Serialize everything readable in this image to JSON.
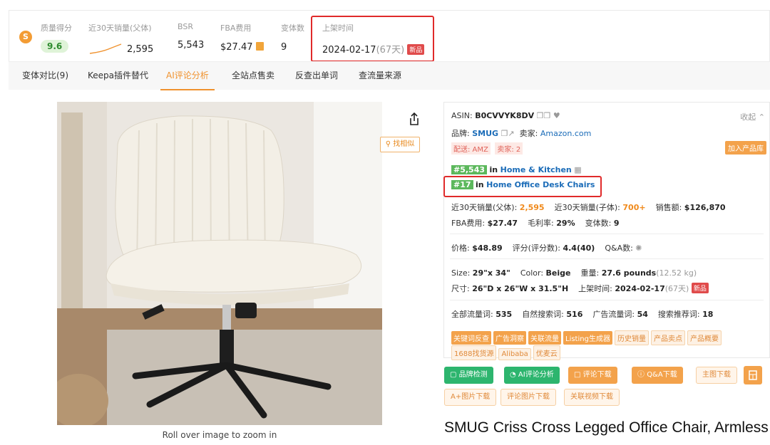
{
  "stats": {
    "quality_label": "质量得分",
    "quality_value": "9.6",
    "sales30_label": "近30天销量(父体)",
    "sales30_value": "2,595",
    "bsr_label": "BSR",
    "bsr_value": "5,543",
    "fba_label": "FBA费用",
    "fba_value": "$27.47",
    "variants_label": "变体数",
    "variants_value": "9",
    "listed_label": "上架时间",
    "listed_date": "2024-02-17",
    "listed_days": "(67天)",
    "new_tag": "新品"
  },
  "tabs": [
    "变体对比(9)",
    "Keepa插件替代",
    "AI评论分析",
    "全站点售卖",
    "反查出单词",
    "查流量来源"
  ],
  "active_tab": "AI评论分析",
  "image": {
    "caption": "Roll over image to zoom in",
    "similar_button": "找相似"
  },
  "info": {
    "asin_label": "ASIN:",
    "asin": "B0CVVYK8DV",
    "collapse": "收起",
    "brand_label": "品牌:",
    "brand": "SMUG",
    "seller_label": "卖家:",
    "seller": "Amazon.com",
    "ship_tag": "配送: AMZ",
    "seller_count_tag": "卖家: 2",
    "add_library": "加入产品库",
    "rank1": "#5,543",
    "rank1_in": "in",
    "rank1_cat": "Home & Kitchen",
    "rank2": "#17",
    "rank2_in": "in",
    "rank2_cat": "Home Office Desk Chairs",
    "sales_parent_label": "近30天销量(父体):",
    "sales_parent": "2,595",
    "sales_child_label": "近30天销量(子体):",
    "sales_child": "700+",
    "revenue_label": "销售额:",
    "revenue": "$126,870",
    "fba_label": "FBA费用:",
    "fba": "$27.47",
    "margin_label": "毛利率:",
    "margin": "29%",
    "variants_label": "变体数:",
    "variants": "9",
    "price_label": "价格:",
    "price": "$48.89",
    "rating_label": "评分(评分数):",
    "rating": "4.4(40)",
    "qa_label": "Q&A数:",
    "size_label": "Size:",
    "size": "29\"x 34\"",
    "color_label": "Color:",
    "color": "Beige",
    "weight_label": "重量:",
    "weight": "27.6 pounds",
    "weight_kg": "(12.52 kg)",
    "dims_label": "尺寸:",
    "dims": "26\"D x 26\"W x 31.5\"H",
    "listed_label": "上架时间:",
    "listed": "2024-02-17",
    "listed_days": "(67天)",
    "new_tag": "新品",
    "traffic_total_label": "全部流量词:",
    "traffic_total": "535",
    "organic_label": "自然搜索词:",
    "organic": "516",
    "ad_label": "广告流量词:",
    "ad": "54",
    "recommend_label": "搜索推荐词:",
    "recommend": "18"
  },
  "tool_tags_solid": [
    "关键词反查",
    "广告洞察",
    "关联流量",
    "Listing生成器"
  ],
  "tool_tags_outline": [
    "历史销量",
    "产品卖点",
    "产品概要"
  ],
  "tool_tags_row2": [
    "1688找货源",
    "Alibaba",
    "优麦云"
  ],
  "buttons": {
    "brand_check": "品牌检测",
    "ai_review": "AI评论分析",
    "review_download": "评论下载",
    "qa_download": "Q&A下载",
    "main_image_download": "主图下载",
    "aplus_download": "A+图片下载",
    "review_image_download": "评论图片下载",
    "related_video_download": "关联视频下载"
  },
  "product_title": "SMUG Criss Cross Legged Office Chair, Armless",
  "colors": {
    "accent": "#f0922e",
    "link": "#1b6cb8",
    "highlight": "#e02a2a",
    "green": "#2db56e"
  }
}
